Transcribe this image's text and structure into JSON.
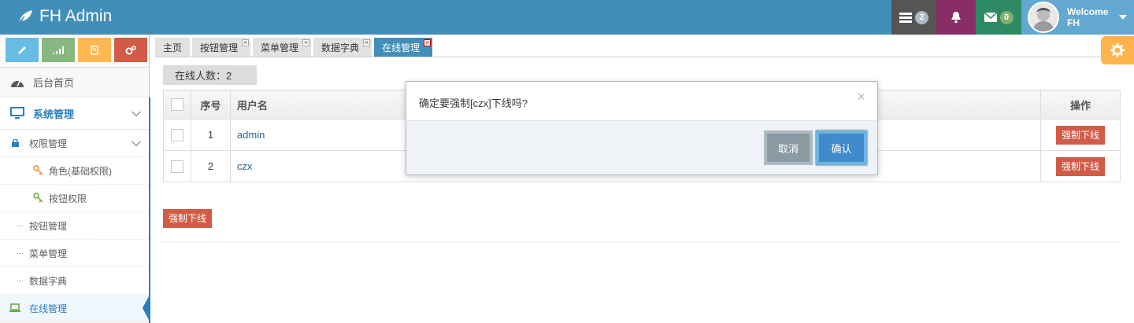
{
  "brand": {
    "title": "FH Admin"
  },
  "navbar": {
    "tasks_count": "2",
    "messages_count": "0",
    "user_welcome": "Welcome",
    "user_name": "FH"
  },
  "sidebar": {
    "home": "后台首页",
    "system_mgmt": "系统管理",
    "perm_mgmt": "权限管理",
    "role": "角色(基础权限)",
    "button_perm": "按钮权限",
    "button_mgmt": "按钮管理",
    "menu_mgmt": "菜单管理",
    "dict": "数据字典",
    "online_mgmt": "在线管理"
  },
  "tabs": [
    {
      "label": "主页"
    },
    {
      "label": "按钮管理"
    },
    {
      "label": "菜单管理"
    },
    {
      "label": "数据字典"
    },
    {
      "label": "在线管理"
    }
  ],
  "online": {
    "label": "在线人数：2"
  },
  "table": {
    "headers": {
      "seq": "序号",
      "username": "用户名",
      "ops": "操作"
    },
    "rows": [
      {
        "seq": "1",
        "username": "admin",
        "action": "强制下线"
      },
      {
        "seq": "2",
        "username": "czx",
        "action": "强制下线"
      }
    ]
  },
  "bottom_button": "强制下线",
  "modal": {
    "message": "确定要强制[czx]下线吗?",
    "close": "×",
    "cancel": "取消",
    "confirm": "确认"
  },
  "colors": {
    "navbar": "#438eb9",
    "danger": "#d15b47",
    "primary": "#428bca"
  }
}
